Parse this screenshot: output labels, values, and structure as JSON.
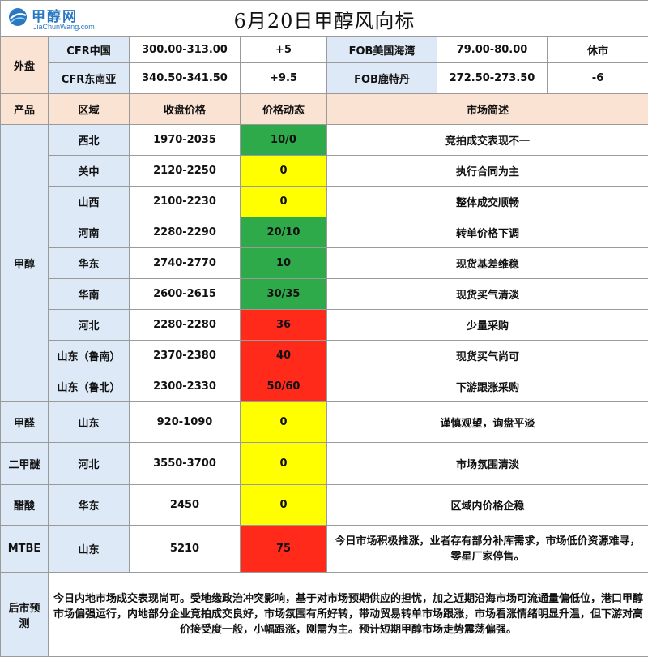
{
  "title": "6月20日甲醇风向标",
  "logo": {
    "cn": "甲醇网",
    "en": "JiaChunWang.com"
  },
  "external": {
    "label": "外盘",
    "rows": [
      {
        "name1": "CFR中国",
        "price1": "300.00-313.00",
        "chg1": "+5",
        "name2": "FOB美国海湾",
        "price2": "79.00-80.00",
        "chg2": "休市"
      },
      {
        "name1": "CFR东南亚",
        "price1": "340.50-341.50",
        "chg1": "+9.5",
        "name2": "FOB鹿特丹",
        "price2": "272.50-273.50",
        "chg2": "-6"
      }
    ]
  },
  "header": {
    "product": "产品",
    "region": "区域",
    "price": "收盘价格",
    "change": "价格动态",
    "comment": "市场简述"
  },
  "methanol": {
    "label": "甲醇",
    "rows": [
      {
        "region": "西北",
        "price": "1970-2035",
        "change": "10/0",
        "status": "green",
        "comment": "竞拍成交表现不一"
      },
      {
        "region": "关中",
        "price": "2120-2250",
        "change": "0",
        "status": "yellow",
        "comment": "执行合同为主"
      },
      {
        "region": "山西",
        "price": "2100-2230",
        "change": "0",
        "status": "yellow",
        "comment": "整体成交顺畅"
      },
      {
        "region": "河南",
        "price": "2280-2290",
        "change": "20/10",
        "status": "green",
        "comment": "转单价格下调"
      },
      {
        "region": "华东",
        "price": "2740-2770",
        "change": "10",
        "status": "green",
        "comment": "现货基差维稳"
      },
      {
        "region": "华南",
        "price": "2600-2615",
        "change": "30/35",
        "status": "green",
        "comment": "现货买气清淡"
      },
      {
        "region": "河北",
        "price": "2280-2280",
        "change": "36",
        "status": "red",
        "comment": "少量采购"
      },
      {
        "region": "山东（鲁南）",
        "price": "2370-2380",
        "change": "40",
        "status": "red",
        "comment": "现货买气尚可"
      },
      {
        "region": "山东（鲁北）",
        "price": "2300-2330",
        "change": "50/60",
        "status": "red",
        "comment": "下游跟涨采购"
      }
    ]
  },
  "others": [
    {
      "product": "甲醛",
      "region": "山东",
      "price": "920-1090",
      "change": "0",
      "status": "yellow",
      "comment": "谨慎观望，询盘平淡"
    },
    {
      "product": "二甲醚",
      "region": "河北",
      "price": "3550-3700",
      "change": "0",
      "status": "yellow",
      "comment": "市场氛围清淡"
    },
    {
      "product": "醋酸",
      "region": "华东",
      "price": "2450",
      "change": "0",
      "status": "yellow",
      "comment": "区域内价格企稳"
    },
    {
      "product": "MTBE",
      "region": "山东",
      "price": "5210",
      "change": "75",
      "status": "red",
      "comment": "今日市场积极推涨，业者存有部分补库需求，市场低价资源难寻，零星厂家停售。"
    }
  ],
  "forecast": {
    "label": "后市预测",
    "text": "今日内地市场成交表现尚可。受地缘政治冲突影响，基于对市场预期供应的担忧，加之近期沿海市场可流通量偏低位，港口甲醇市场偏强运行，内地部分企业竞拍成交良好，市场氛围有所好转，带动贸易转单市场跟涨，市场看涨情绪明显升温，但下游对高价接受度一般，小幅跟涨，刚需为主。预计短期甲醇市场走势震荡偏强。"
  },
  "colors": {
    "green": "#2eaa4a",
    "yellow": "#ffff00",
    "red": "#ff2a1a",
    "peach": "#fbe3d3",
    "light_blue": "#dde9f6"
  }
}
